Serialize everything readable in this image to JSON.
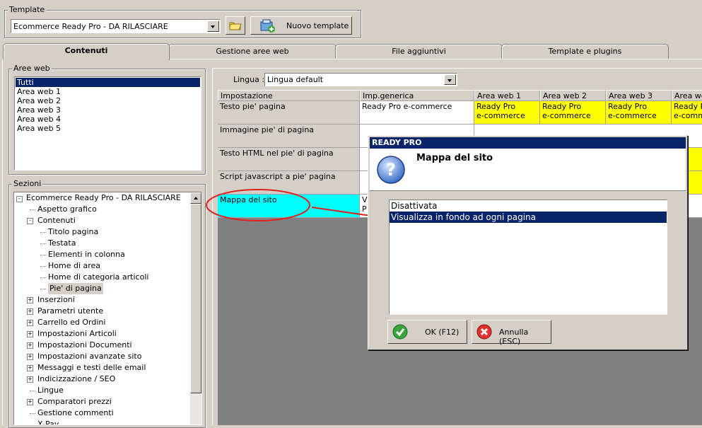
{
  "template": {
    "group_label": "Template",
    "selected": "Ecommerce Ready Pro - DA RILASCIARE",
    "new_button": "Nuovo template"
  },
  "tabs": [
    {
      "label": "Contenuti",
      "active": true
    },
    {
      "label": "Gestione aree web",
      "active": false
    },
    {
      "label": "File aggiuntivi",
      "active": false
    },
    {
      "label": "Template e plugins",
      "active": false
    }
  ],
  "aree_web": {
    "group_label": "Aree web",
    "items": [
      "Tutti",
      "Area web 1",
      "Area web 2",
      "Area web 3",
      "Area web 4",
      "Area web 5"
    ],
    "selected_index": 0
  },
  "sezioni": {
    "group_label": "Sezioni",
    "root": "Ecommerce Ready Pro - DA RILASCIARE",
    "items": [
      {
        "label": "Aspetto grafico",
        "level": 1
      },
      {
        "label": "Contenuti",
        "level": 1,
        "expander": "-"
      },
      {
        "label": "Titolo pagina",
        "level": 2
      },
      {
        "label": "Testata",
        "level": 2
      },
      {
        "label": "Elementi in colonna",
        "level": 2
      },
      {
        "label": "Home di area",
        "level": 2
      },
      {
        "label": "Home di categoria articoli",
        "level": 2
      },
      {
        "label": "Pie' di pagina",
        "level": 2,
        "selected": true
      },
      {
        "label": "Inserzioni",
        "level": 1,
        "expander": "+"
      },
      {
        "label": "Parametri utente",
        "level": 1,
        "expander": "+"
      },
      {
        "label": "Carrello ed Ordini",
        "level": 1,
        "expander": "+"
      },
      {
        "label": "Impostazioni Articoli",
        "level": 1,
        "expander": "+"
      },
      {
        "label": "Impostazioni Documenti",
        "level": 1,
        "expander": "+"
      },
      {
        "label": "Impostazioni avanzate sito",
        "level": 1,
        "expander": "+"
      },
      {
        "label": "Messaggi e testi delle email",
        "level": 1,
        "expander": "+"
      },
      {
        "label": "Indicizzazione / SEO",
        "level": 1,
        "expander": "+"
      },
      {
        "label": "Lingue",
        "level": 1
      },
      {
        "label": "Comparatori prezzi",
        "level": 1,
        "expander": "+"
      },
      {
        "label": "Gestione commenti",
        "level": 1
      },
      {
        "label": "X-Pay",
        "level": 1
      }
    ]
  },
  "lingua": {
    "label": "Lingua :",
    "selected": "Lingua default"
  },
  "grid": {
    "headers": [
      "Impostazione",
      "Imp.generica",
      "Area web 1",
      "Area web 2",
      "Area web 3",
      "Area we"
    ],
    "rows": [
      {
        "setting": "Testo pie' pagina",
        "generic": "Ready Pro e-commerce",
        "area_values": [
          "Ready Pro\ne-commerce",
          "Ready Pro\ne-commerce",
          "Ready Pro\ne-commerce",
          "Ready P\ne-comm"
        ]
      },
      {
        "setting": "Immagine pie' di pagina",
        "generic": "",
        "area_values": []
      },
      {
        "setting": "Testo HTML nel pie' di pagina",
        "generic": "",
        "area_values": []
      },
      {
        "setting": "Script javascript a pie' pagina",
        "generic": "",
        "area_values": []
      },
      {
        "setting": "Mappa del sito",
        "generic": "V\nP",
        "area_values": []
      }
    ]
  },
  "dialog": {
    "title": "READY PRO",
    "heading": "Mappa del sito",
    "options": [
      "Disattivata",
      "Visualizza in fondo ad ogni pagina"
    ],
    "selected_index": 1,
    "ok_label": "OK (F12)",
    "cancel_label": "Annulla (ESC)"
  },
  "colors": {
    "selection": "#0a246a",
    "highlight_yellow": "#ffff00",
    "highlight_cyan": "#00ffff",
    "annotation_red": "#e02020",
    "dialog_title_bg": "#0a246a"
  }
}
